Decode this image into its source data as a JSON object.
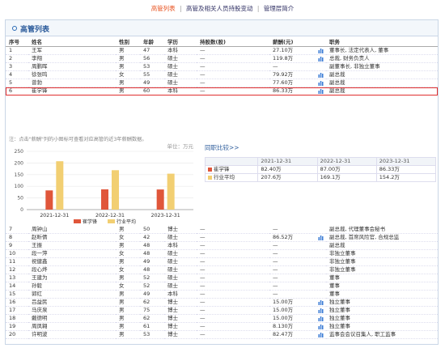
{
  "tabs": [
    {
      "label": "高管列表",
      "active": true
    },
    {
      "label": "高管及相关人员持股变动",
      "active": false
    },
    {
      "label": "管理层简介",
      "active": false
    }
  ],
  "separator": "|",
  "panel_title": "高管列表",
  "columns": [
    "序号",
    "姓名",
    "性别",
    "年龄",
    "学历",
    "持股数(股)",
    "薪酬(元)",
    "职务"
  ],
  "rows_top": [
    {
      "no": "1",
      "name": "王军",
      "sex": "男",
      "age": "47",
      "edu": "本科",
      "shares": "—",
      "pay": "27.10万",
      "icon": true,
      "title": "董事长, 法定代表人, 董事"
    },
    {
      "no": "2",
      "name": "李翔",
      "sex": "男",
      "age": "56",
      "edu": "硕士",
      "shares": "—",
      "pay": "119.8万",
      "icon": true,
      "title": "总裁, 财务负责人"
    },
    {
      "no": "3",
      "name": "周鹏晖",
      "sex": "男",
      "age": "53",
      "edu": "硕士",
      "shares": "—",
      "pay": "—",
      "icon": false,
      "title": "副董事长, 非独立董事"
    },
    {
      "no": "4",
      "name": "徐张鸣",
      "sex": "女",
      "age": "55",
      "edu": "硕士",
      "shares": "—",
      "pay": "79.92万",
      "icon": true,
      "title": "副总裁"
    },
    {
      "no": "5",
      "name": "曾勃",
      "sex": "男",
      "age": "49",
      "edu": "硕士",
      "shares": "—",
      "pay": "77.60万",
      "icon": true,
      "title": "副总裁"
    },
    {
      "no": "6",
      "name": "崔学锋",
      "sex": "男",
      "age": "60",
      "edu": "本科",
      "shares": "—",
      "pay": "86.33万",
      "icon": true,
      "title": "副总裁",
      "highlight": true
    }
  ],
  "note": "注：点击\"薪酬\"列的小图标可查看对应高管的近3年薪酬数据。",
  "chart_data": {
    "type": "bar",
    "unit": "单位：万元",
    "categories": [
      "2021-12-31",
      "2022-12-31",
      "2023-12-31"
    ],
    "series": [
      {
        "name": "崔学锋",
        "values": [
          82.4,
          87.0,
          86.33
        ],
        "color": "#e0563a"
      },
      {
        "name": "行业平均",
        "values": [
          207.6,
          169.1,
          154.2
        ],
        "color": "#f2cf72"
      }
    ],
    "ylim": [
      0,
      250
    ],
    "yticks": [
      0,
      50,
      100,
      150,
      200,
      250
    ]
  },
  "compare": {
    "label": "同职比较>>",
    "headers": [
      "",
      "2021-12-31",
      "2022-12-31",
      "2023-12-31"
    ],
    "rows": [
      {
        "name": "崔学锋",
        "color": "#e0563a",
        "vals": [
          "82.40万",
          "87.00万",
          "86.33万"
        ]
      },
      {
        "name": "行业平均",
        "color": "#f2cf72",
        "vals": [
          "207.6万",
          "169.1万",
          "154.2万"
        ]
      }
    ]
  },
  "rows_bottom": [
    {
      "no": "7",
      "name": "周钟山",
      "sex": "男",
      "age": "50",
      "edu": "博士",
      "shares": "—",
      "pay": "—",
      "icon": false,
      "title": "副总裁, 代理董事会秘书"
    },
    {
      "no": "8",
      "name": "赵昕倩",
      "sex": "女",
      "age": "42",
      "edu": "硕士",
      "shares": "—",
      "pay": "86.52万",
      "icon": true,
      "title": "副总裁, 首席风险官, 合规总监"
    },
    {
      "no": "9",
      "name": "王振",
      "sex": "男",
      "age": "48",
      "edu": "本科",
      "shares": "—",
      "pay": "—",
      "icon": false,
      "title": "副总裁"
    },
    {
      "no": "10",
      "name": "段一萍",
      "sex": "女",
      "age": "48",
      "edu": "硕士",
      "shares": "—",
      "pay": "—",
      "icon": false,
      "title": "非独立董事"
    },
    {
      "no": "11",
      "name": "祝健鑫",
      "sex": "男",
      "age": "49",
      "edu": "硕士",
      "shares": "—",
      "pay": "—",
      "icon": false,
      "title": "非独立董事"
    },
    {
      "no": "12",
      "name": "段心烨",
      "sex": "女",
      "age": "48",
      "edu": "硕士",
      "shares": "—",
      "pay": "—",
      "icon": false,
      "title": "非独立董事"
    },
    {
      "no": "13",
      "name": "王建为",
      "sex": "男",
      "age": "52",
      "edu": "硕士",
      "shares": "—",
      "pay": "—",
      "icon": false,
      "title": "董事"
    },
    {
      "no": "14",
      "name": "孙毅",
      "sex": "女",
      "age": "52",
      "edu": "硕士",
      "shares": "—",
      "pay": "—",
      "icon": false,
      "title": "董事"
    },
    {
      "no": "15",
      "name": "郭红",
      "sex": "男",
      "age": "49",
      "edu": "本科",
      "shares": "—",
      "pay": "—",
      "icon": false,
      "title": "董事"
    },
    {
      "no": "16",
      "name": "吕益民",
      "sex": "男",
      "age": "62",
      "edu": "博士",
      "shares": "—",
      "pay": "15.00万",
      "icon": true,
      "title": "独立董事"
    },
    {
      "no": "17",
      "name": "马庆泉",
      "sex": "男",
      "age": "75",
      "edu": "博士",
      "shares": "—",
      "pay": "15.00万",
      "icon": true,
      "title": "独立董事"
    },
    {
      "no": "18",
      "name": "戴德明",
      "sex": "男",
      "age": "62",
      "edu": "博士",
      "shares": "—",
      "pay": "15.00万",
      "icon": true,
      "title": "独立董事"
    },
    {
      "no": "19",
      "name": "周凤翱",
      "sex": "男",
      "age": "61",
      "edu": "博士",
      "shares": "—",
      "pay": "8.130万",
      "icon": true,
      "title": "独立董事"
    },
    {
      "no": "20",
      "name": "许明波",
      "sex": "男",
      "age": "53",
      "edu": "博士",
      "shares": "—",
      "pay": "82.47万",
      "icon": true,
      "title": "监事会会议召集人, 职工监事"
    }
  ],
  "colors": {
    "accent": "#e8501d",
    "link": "#2a5a9a",
    "highlight": "#e03030"
  }
}
